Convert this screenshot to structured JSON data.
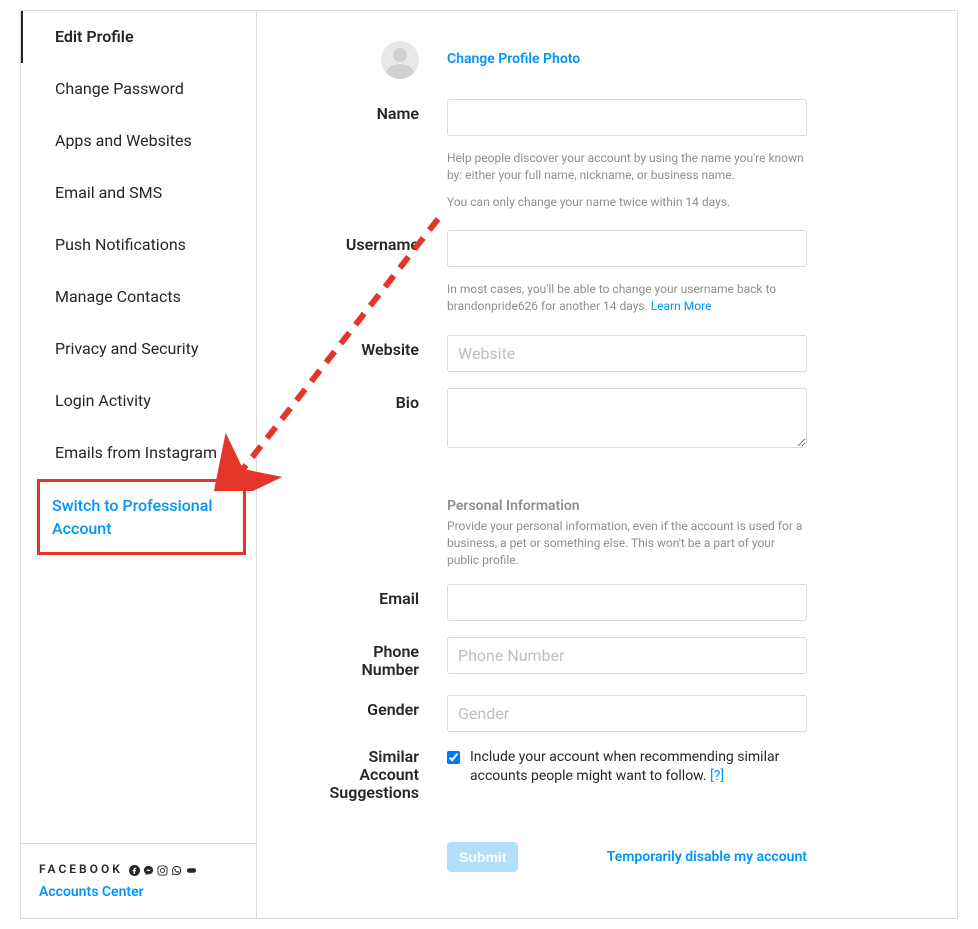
{
  "sidebar": {
    "items": [
      {
        "label": "Edit Profile"
      },
      {
        "label": "Change Password"
      },
      {
        "label": "Apps and Websites"
      },
      {
        "label": "Email and SMS"
      },
      {
        "label": "Push Notifications"
      },
      {
        "label": "Manage Contacts"
      },
      {
        "label": "Privacy and Security"
      },
      {
        "label": "Login Activity"
      },
      {
        "label": "Emails from Instagram"
      }
    ],
    "switch_professional": "Switch to Professional Account",
    "footer": {
      "facebook_label": "FACEBOOK",
      "accounts_center": "Accounts Center"
    }
  },
  "form": {
    "change_photo": "Change Profile Photo",
    "name": {
      "label": "Name",
      "value": "",
      "help1": "Help people discover your account by using the name you're known by: either your full name, nickname, or business name.",
      "help2": "You can only change your name twice within 14 days."
    },
    "username": {
      "label": "Username",
      "value": "",
      "help": "In most cases, you'll be able to change your username back to brandonpride626 for another 14 days. ",
      "learn_more": "Learn More"
    },
    "website": {
      "label": "Website",
      "placeholder": "Website",
      "value": ""
    },
    "bio": {
      "label": "Bio",
      "value": ""
    },
    "personal_info": {
      "heading": "Personal Information",
      "text": "Provide your personal information, even if the account is used for a business, a pet or something else. This won't be a part of your public profile."
    },
    "email": {
      "label": "Email",
      "value": ""
    },
    "phone": {
      "label": "Phone Number",
      "placeholder": "Phone Number",
      "value": ""
    },
    "gender": {
      "label": "Gender",
      "placeholder": "Gender",
      "value": ""
    },
    "suggestions": {
      "label": "Similar Account Suggestions",
      "checkbox_label": "Include your account when recommending similar accounts people might want to follow.",
      "qmark": "[?]",
      "checked": true
    },
    "actions": {
      "submit": "Submit",
      "disable": "Temporarily disable my account"
    }
  }
}
